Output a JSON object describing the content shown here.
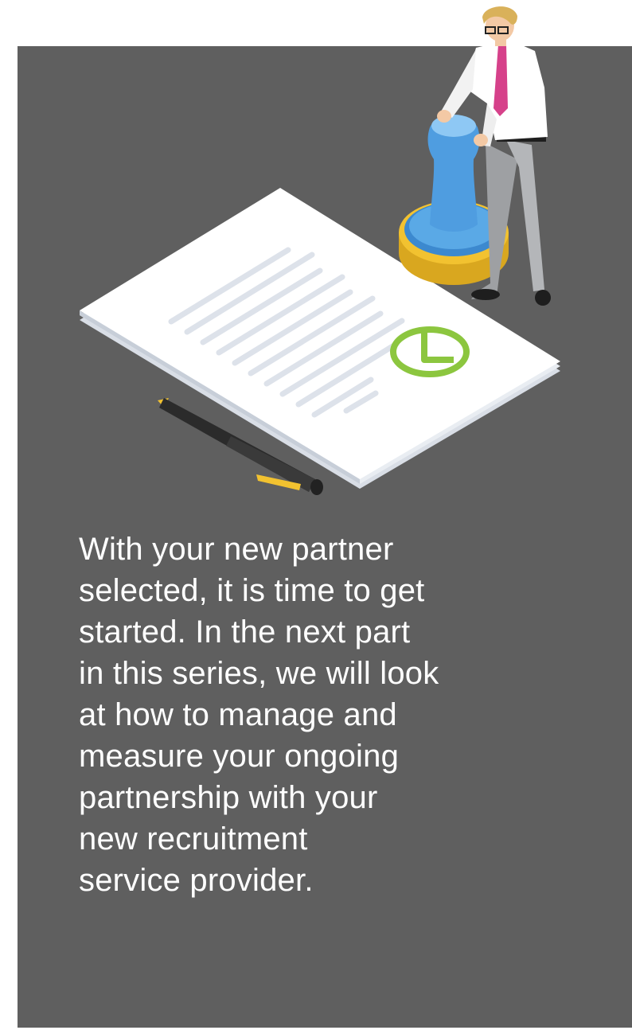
{
  "body": {
    "lines": [
      "With your new partner",
      "selected, it is time to get",
      "started. In the next part",
      "in this series, we will look",
      "at how to manage and",
      "measure your ongoing",
      "partnership with your",
      "new recruitment",
      "service provider."
    ]
  },
  "illustration": {
    "icons": [
      "document-icon",
      "pen-icon",
      "rubber-stamp-icon",
      "businessman-figure",
      "approval-seal-icon"
    ],
    "colors": {
      "panel_background": "#5f5f5f",
      "stamp_blue": "#4fa3e0",
      "stamp_base_yellow": "#f2c230",
      "seal_green": "#8cc63f",
      "tie_pink": "#d6418a"
    }
  }
}
